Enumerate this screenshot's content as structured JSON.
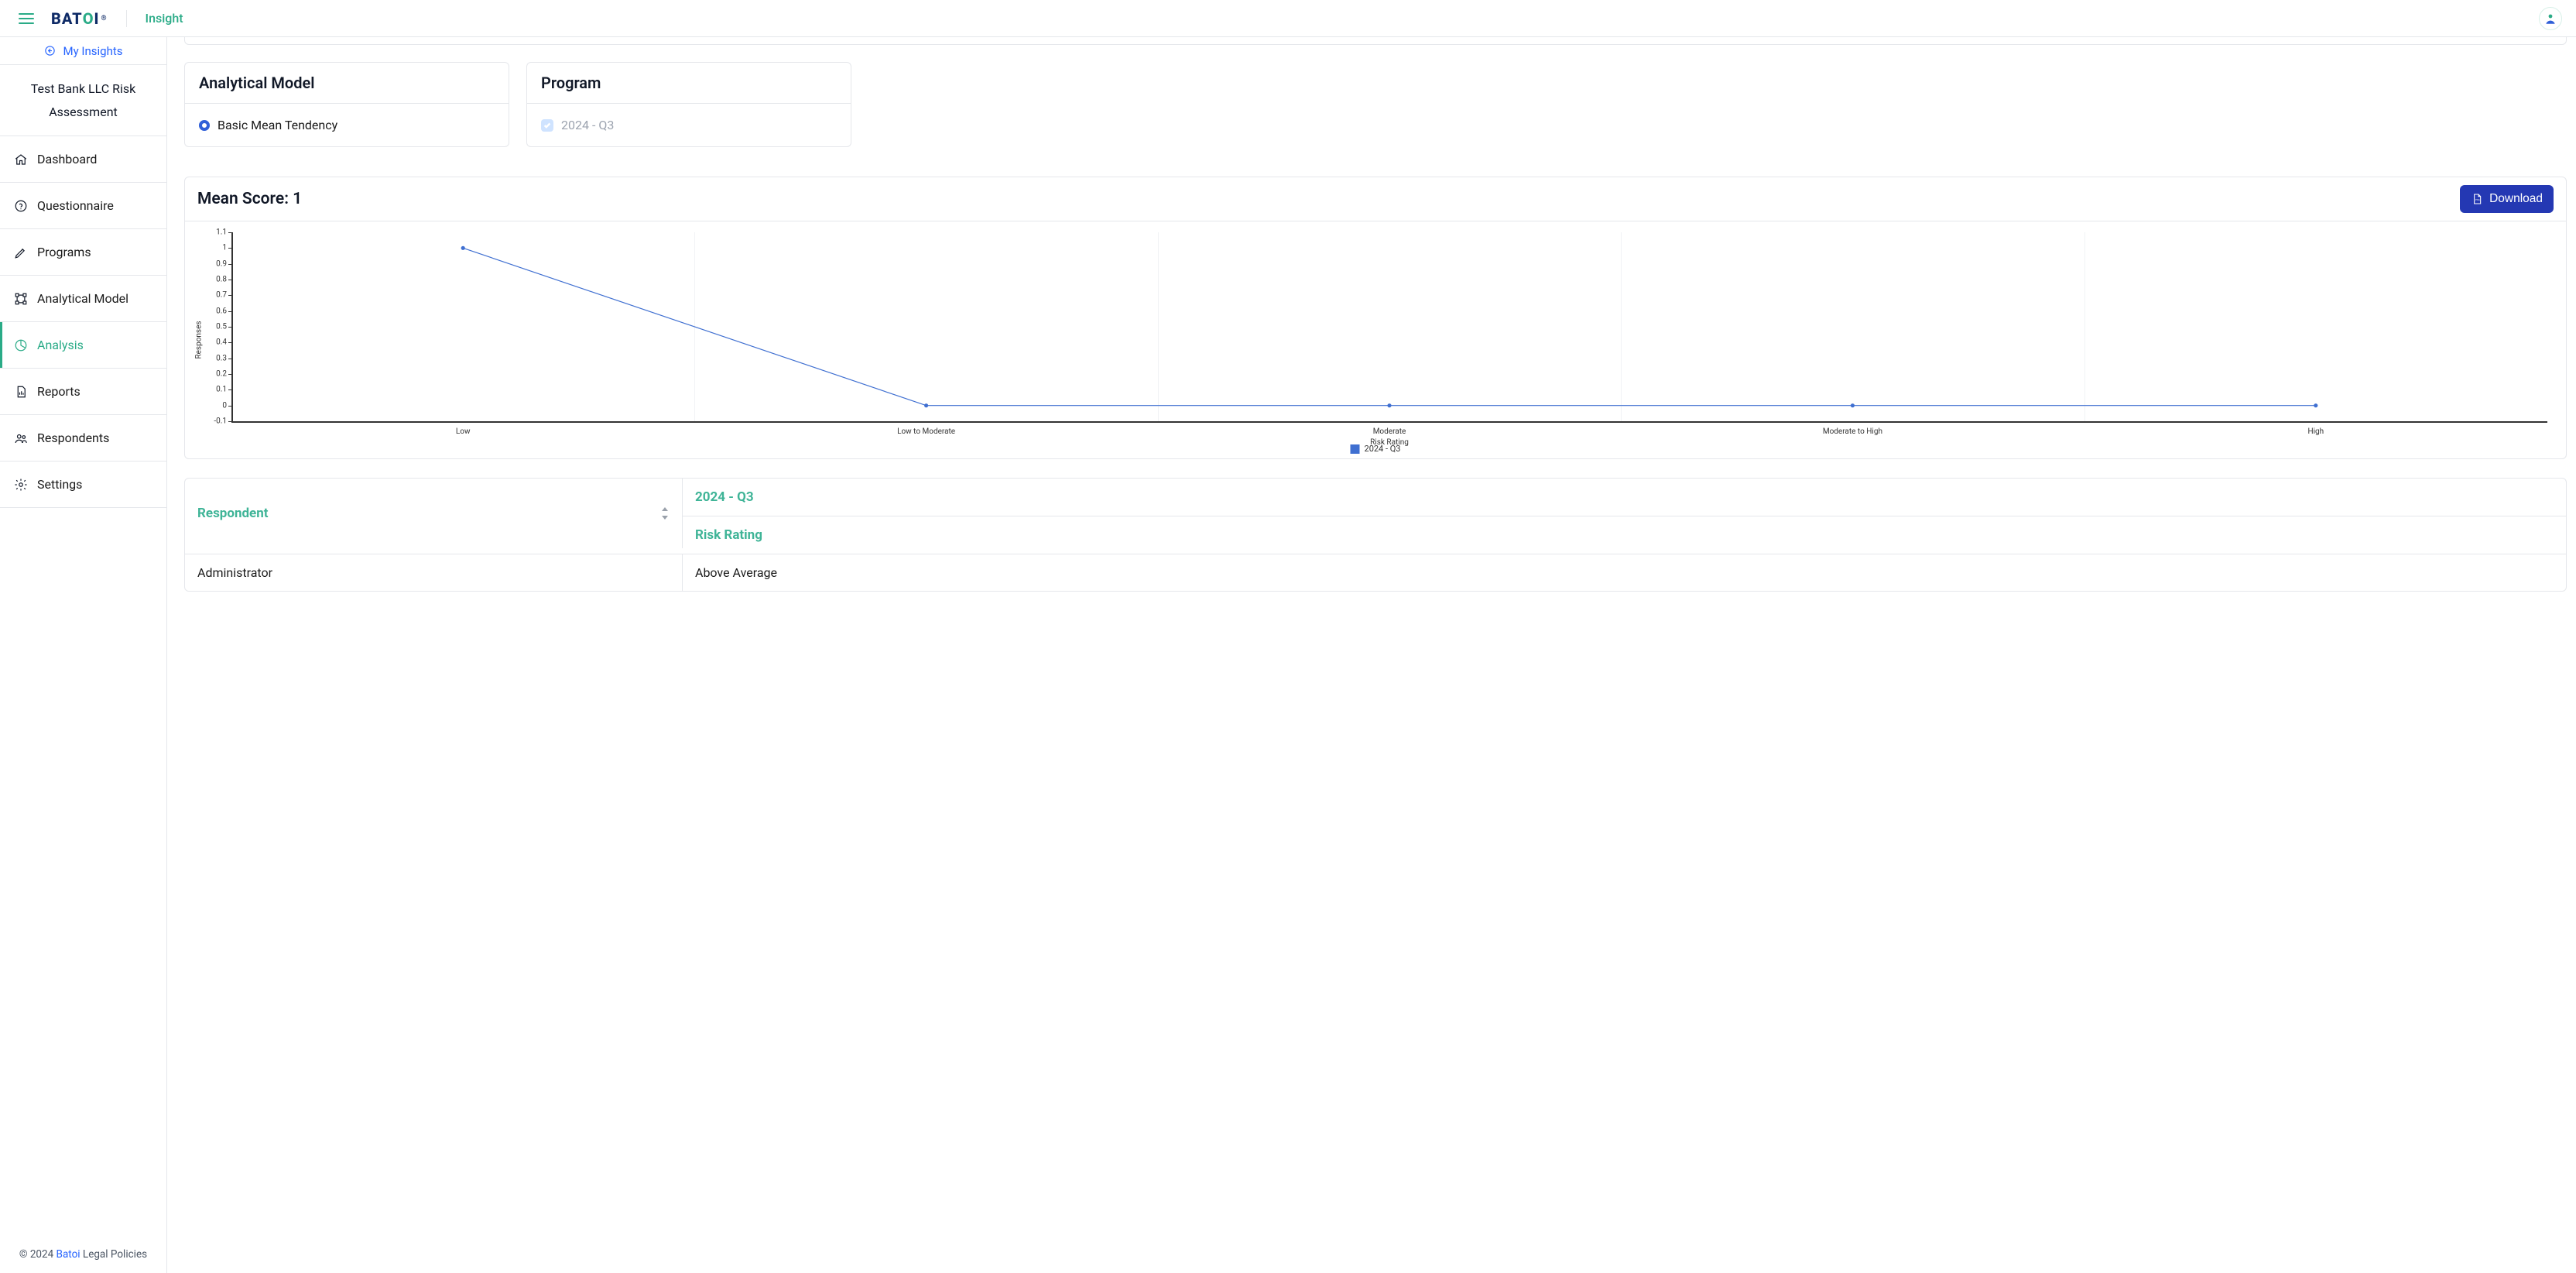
{
  "brand": {
    "name": "BATOI",
    "product": "Insight"
  },
  "my_insights_label": "My Insights",
  "project_name": "Test Bank LLC Risk Assessment",
  "sidebar": {
    "items": [
      {
        "id": "dashboard",
        "label": "Dashboard",
        "icon": "home-icon"
      },
      {
        "id": "questionnaire",
        "label": "Questionnaire",
        "icon": "question-icon"
      },
      {
        "id": "programs",
        "label": "Programs",
        "icon": "pen-icon"
      },
      {
        "id": "analytical-model",
        "label": "Analytical Model",
        "icon": "model-icon"
      },
      {
        "id": "analysis",
        "label": "Analysis",
        "icon": "pie-icon",
        "active": true
      },
      {
        "id": "reports",
        "label": "Reports",
        "icon": "file-chart-icon"
      },
      {
        "id": "respondents",
        "label": "Respondents",
        "icon": "users-icon"
      },
      {
        "id": "settings",
        "label": "Settings",
        "icon": "gear-icon"
      }
    ]
  },
  "footer": {
    "prefix": "© 2024 ",
    "brand": "Batoi",
    "suffix": " Legal Policies"
  },
  "panels": {
    "model": {
      "title": "Analytical Model",
      "option": "Basic Mean Tendency"
    },
    "program": {
      "title": "Program",
      "option": "2024 - Q3"
    }
  },
  "score": {
    "title": "Mean Score: 1",
    "download": "Download"
  },
  "chart_data": {
    "type": "line",
    "title": "",
    "xlabel": "Risk Rating",
    "ylabel": "Responses",
    "ylim": [
      -0.1,
      1.1
    ],
    "yticks": [
      -0.1,
      0,
      0.1,
      0.2,
      0.3,
      0.4,
      0.5,
      0.6,
      0.7,
      0.8,
      0.9,
      1,
      1.1
    ],
    "categories": [
      "Low",
      "Low to Moderate",
      "Moderate",
      "Moderate to High",
      "High"
    ],
    "series": [
      {
        "name": "2024 - Q3",
        "values": [
          1,
          0,
          0,
          0,
          0
        ],
        "color": "#3f6fd1"
      }
    ]
  },
  "table": {
    "headers": {
      "respondent": "Respondent",
      "period": "2024 - Q3",
      "rating": "Risk Rating"
    },
    "rows": [
      {
        "respondent": "Administrator",
        "rating": "Above Average"
      }
    ]
  }
}
